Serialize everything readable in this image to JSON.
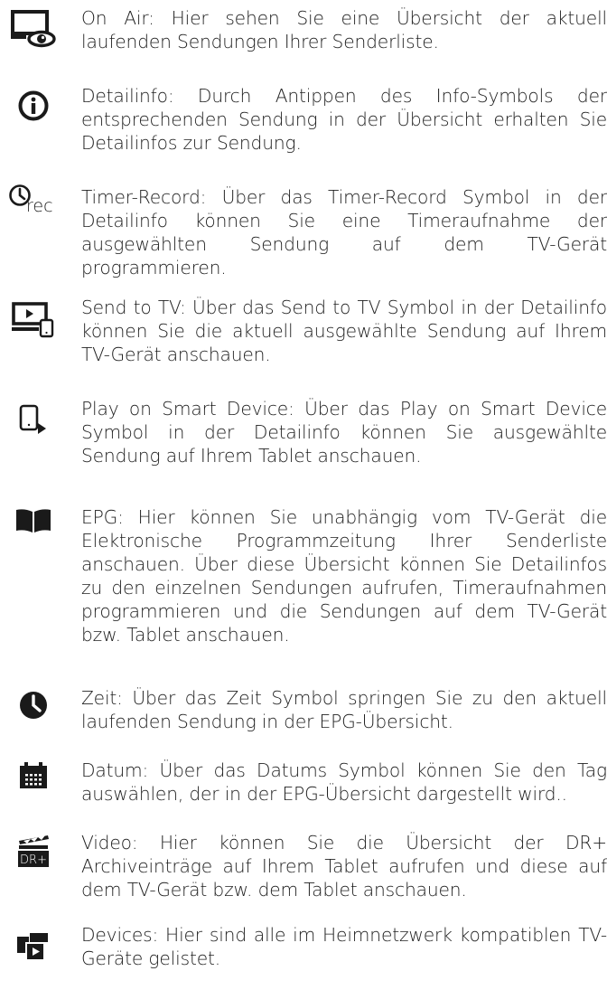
{
  "entries": [
    {
      "icon": "tv-eye-icon",
      "text": "On Air: Hier sehen Sie eine Übersicht der aktuell laufenden Sendungen Ihrer Senderliste."
    },
    {
      "icon": "info-icon",
      "text": "Detailinfo: Durch Antippen des Info-Symbols der entsprechenden Sendung in der Übersicht erhalten Sie Detailinfos zur Sendung."
    },
    {
      "icon": "timer-record-icon",
      "text": "Timer-Record: Über das Timer-Record Symbol in der Detailinfo können Sie eine Timeraufnahme der ausgewählten Sendung auf dem TV-Gerät programmieren."
    },
    {
      "icon": "send-to-tv-icon",
      "text": "Send to TV: Über das Send to TV Symbol in der Detailinfo können Sie die aktuell ausgewählte Sendung auf Ihrem TV-Gerät anschauen."
    },
    {
      "icon": "play-on-device-icon",
      "text": "Play on Smart Device: Über das Play on Smart Device Symbol in der Detailinfo können Sie ausgewählte Sendung auf Ihrem Tablet anschauen."
    },
    {
      "icon": "book-icon",
      "text": "EPG: Hier können Sie unabhängig vom TV-Gerät die Elektronische Programmzeitung Ihrer Senderliste anschauen. Über diese Übersicht können Sie Detailinfos zu den einzelnen Sendungen aufrufen, Timeraufnahmen programmieren und die Sendungen auf dem TV-Gerät bzw. Tablet anschauen."
    },
    {
      "icon": "clock-icon",
      "text": "Zeit: Über das Zeit Symbol springen Sie zu den aktuell laufenden Sendung in der EPG-Übersicht."
    },
    {
      "icon": "calendar-icon",
      "text": "Datum: Über das Datums Symbol können Sie den Tag auswählen, der in der EPG-Übersicht dargestellt wird.."
    },
    {
      "icon": "video-dr-icon",
      "text": "Video: Hier können Sie die Übersicht der DR+ Archiveinträge auf Ihrem Tablet aufrufen und diese auf dem TV-Gerät bzw. dem Tablet anschauen."
    },
    {
      "icon": "devices-icon",
      "text": "Devices: Hier sind alle im Heimnetzwerk kompatiblen TV-Geräte gelistet."
    }
  ],
  "icon_labels": {
    "rec": "rec",
    "dr": "DR+"
  },
  "colors": {
    "text": "#1e1e1e",
    "icon": "#1a1a1a"
  }
}
